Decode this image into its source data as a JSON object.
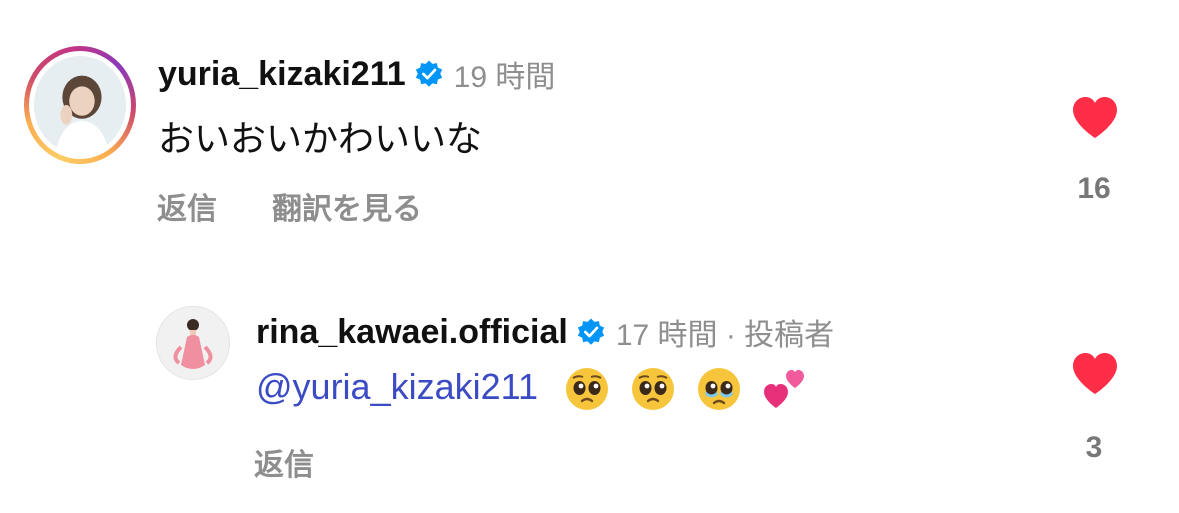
{
  "comments": [
    {
      "username": "yuria_kizaki211",
      "timestamp": "19 時間",
      "text": "おいおいかわいいな",
      "reply_label": "返信",
      "translate_label": "翻訳を見る",
      "like_count": "16",
      "has_story_ring": true
    }
  ],
  "replies": [
    {
      "username": "rina_kawaei.official",
      "timestamp": "17 時間 · 投稿者",
      "mention": "@yuria_kizaki211",
      "emojis": [
        "pleading-face",
        "pleading-face",
        "face-holding-back-tears",
        "two-hearts"
      ],
      "reply_label": "返信",
      "like_count": "3"
    }
  ],
  "colors": {
    "heart": "#ff2d46",
    "verified": "#0095f6",
    "mention": "#3b4bc3",
    "muted": "#8e8e8e"
  },
  "icons": [
    "verified-badge-icon",
    "heart-icon"
  ]
}
